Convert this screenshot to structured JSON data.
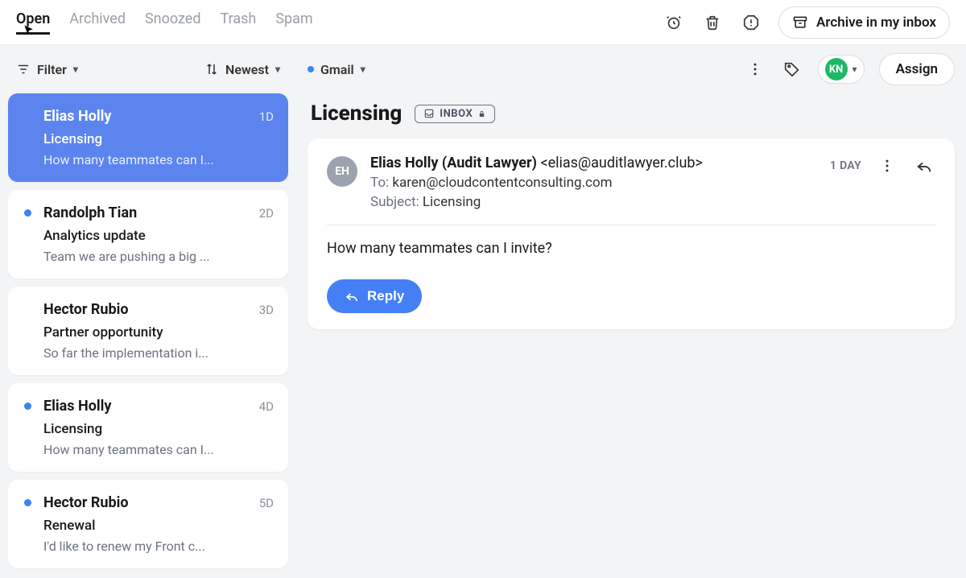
{
  "tabs": {
    "open": "Open",
    "archived": "Archived",
    "snoozed": "Snoozed",
    "trash": "Trash",
    "spam": "Spam"
  },
  "topActions": {
    "archive_label": "Archive in my inbox"
  },
  "toolbar": {
    "filter_label": "Filter",
    "sort_label": "Newest"
  },
  "conversations": [
    {
      "sender": "Elias Holly",
      "age": "1D",
      "subject": "Licensing",
      "preview": "How many teammates can I...",
      "unread": false,
      "selected": true
    },
    {
      "sender": "Randolph Tian",
      "age": "2D",
      "subject": "Analytics update",
      "preview": "Team we are pushing a big ...",
      "unread": true
    },
    {
      "sender": "Hector Rubio",
      "age": "3D",
      "subject": "Partner opportunity",
      "preview": "So far the implementation i...",
      "unread": false
    },
    {
      "sender": "Elias Holly",
      "age": "4D",
      "subject": "Licensing",
      "preview": "How many teammates can I...",
      "unread": true
    },
    {
      "sender": "Hector Rubio",
      "age": "5D",
      "subject": "Renewal",
      "preview": "I'd like to renew my Front c...",
      "unread": true
    }
  ],
  "detail": {
    "account_label": "Gmail",
    "assignee_initials": "KN",
    "assign_label": "Assign",
    "title": "Licensing",
    "inbox_badge": "INBOX",
    "message": {
      "sender_initials": "EH",
      "sender_name": "Elias Holly (Audit Lawyer)",
      "sender_email": "<elias@auditlawyer.club>",
      "to_label": "To:",
      "to_value": "karen@cloudcontentconsulting.com",
      "subject_label": "Subject:",
      "subject_value": "Licensing",
      "age": "1 DAY",
      "body": "How many teammates can I invite?",
      "reply_label": "Reply"
    }
  }
}
